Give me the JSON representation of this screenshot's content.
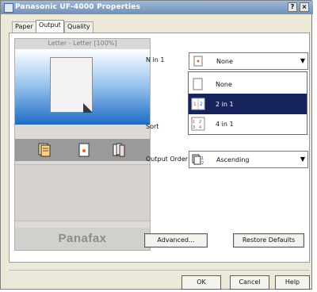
{
  "window": {
    "title": "Panasonic UF-4000 Properties",
    "help_button": "?",
    "close_button": "×"
  },
  "tabs": [
    {
      "label": "Paper"
    },
    {
      "label": "Output"
    },
    {
      "label": "Quality"
    }
  ],
  "preview": {
    "paper_caption": "Letter - Letter [100%]",
    "brand": "Panafax"
  },
  "n_in_1": {
    "label": "N in 1",
    "selected_value": "None",
    "options": [
      "None",
      "2 in 1",
      "4 in 1"
    ],
    "highlighted": "2 in 1"
  },
  "sort": {
    "label": "Sort"
  },
  "output_order": {
    "label": "Output Order",
    "value": "Ascending"
  },
  "buttons": {
    "advanced": "Advanced...",
    "restore_defaults": "Restore Defaults",
    "ok": "OK",
    "cancel": "Cancel",
    "help": "Help"
  },
  "colors": {
    "titlebar": "#7f9fc6",
    "selection": "#17235c",
    "preview_blue": "#1f6cc7"
  }
}
